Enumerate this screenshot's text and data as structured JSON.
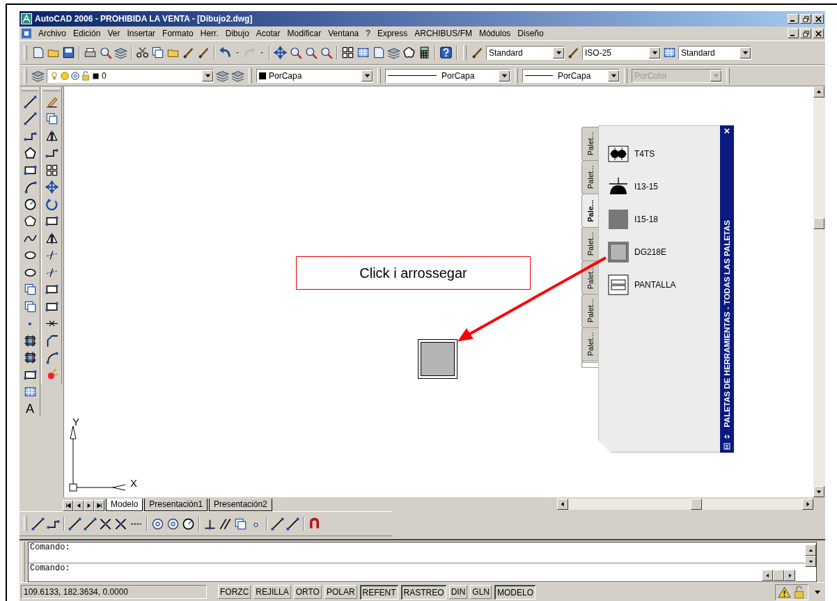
{
  "window": {
    "title": "AutoCAD 2006 - PROHIBIDA LA VENTA - [Dibujo2.dwg]"
  },
  "menu": [
    "Archivo",
    "Edición",
    "Ver",
    "Insertar",
    "Formato",
    "Herr.",
    "Dibujo",
    "Acotar",
    "Modificar",
    "Ventana",
    "?",
    "Express",
    "ARCHIBUS/FM",
    "Módulos",
    "Diseño"
  ],
  "styles_toolbar": [
    {
      "kind": "text",
      "value": "Standard"
    },
    {
      "kind": "dimension",
      "value": "ISO-25"
    },
    {
      "kind": "table",
      "value": "Standard"
    }
  ],
  "layers_toolbar": {
    "layer": "0"
  },
  "properties_toolbar": [
    {
      "kind": "color",
      "value": "PorCapa",
      "disabled": false
    },
    {
      "kind": "linetype",
      "value": "PorCapa",
      "disabled": false
    },
    {
      "kind": "lineweight",
      "value": "PorCapa",
      "disabled": false
    },
    {
      "kind": "plotstyle",
      "value": "PorColor",
      "disabled": true
    }
  ],
  "draw_toolbar": {
    "text_tool": "A"
  },
  "canvas": {
    "callout": "Click i arrossegar",
    "ucs": {
      "y_label": "Y",
      "x_label": "X"
    }
  },
  "tool_palette": {
    "title": "PALETAS DE HERRAMIENTAS - TODAS LAS PALETAS",
    "close": "×",
    "tabs": [
      {
        "label": "Palet...",
        "selected": false
      },
      {
        "label": "Palet...",
        "selected": false
      },
      {
        "label": "Pale...",
        "selected": true
      },
      {
        "label": "Palet...",
        "selected": false
      },
      {
        "label": "Palet...",
        "selected": false
      },
      {
        "label": "Palet...",
        "selected": false
      },
      {
        "label": "Palet...",
        "selected": false
      }
    ],
    "items": [
      {
        "kind": "fixture",
        "label": "T4TS"
      },
      {
        "kind": "pendant",
        "label": "I13-15"
      },
      {
        "kind": "solid",
        "label": "I15-18"
      },
      {
        "kind": "framed",
        "label": "DG218E"
      },
      {
        "kind": "screen",
        "label": "PANTALLA"
      }
    ]
  },
  "layout_tabs": [
    {
      "label": "Modelo",
      "selected": true
    },
    {
      "label": "Presentación1",
      "selected": false
    },
    {
      "label": "Presentación2",
      "selected": false
    }
  ],
  "command_lines": [
    "Comando:",
    "Comando:"
  ],
  "status_bar": {
    "coordinates": "109.6133, 182.3634, 0.0000",
    "toggles": [
      {
        "label": "FORZC",
        "on": false
      },
      {
        "label": "REJILLA",
        "on": false
      },
      {
        "label": "ORTO",
        "on": false
      },
      {
        "label": "POLAR",
        "on": false
      },
      {
        "label": "REFENT",
        "on": true
      },
      {
        "label": "RASTREO",
        "on": true
      },
      {
        "label": "DIN",
        "on": false
      },
      {
        "label": "GLN",
        "on": false
      },
      {
        "label": "MODELO",
        "on": true
      }
    ]
  }
}
